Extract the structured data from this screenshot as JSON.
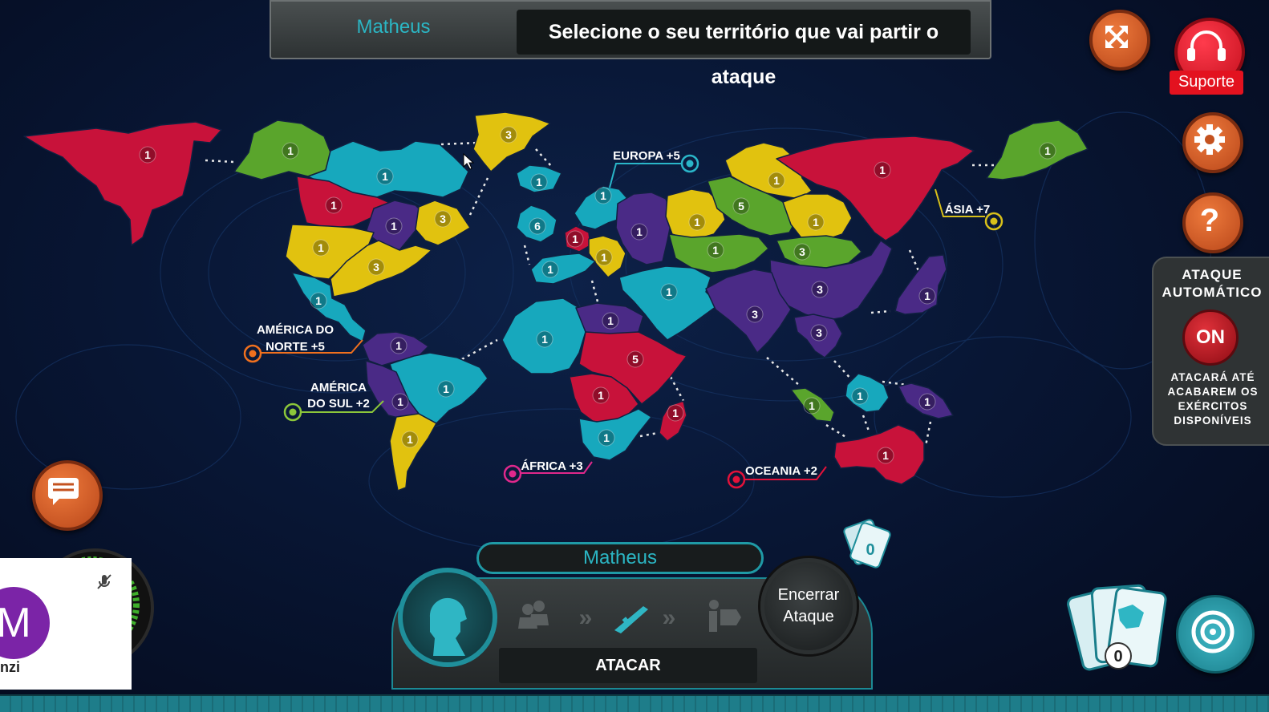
{
  "top_bar": {
    "player_name": "Matheus",
    "instruction": "Selecione o seu território que vai partir o ataque"
  },
  "support": {
    "label": "Suporte"
  },
  "auto_attack": {
    "title_line1": "ATAQUE",
    "title_line2": "AUTOMÁTICO",
    "toggle": "ON",
    "desc_line1": "ATACARÁ ATÉ",
    "desc_line2": "ACABAREM OS",
    "desc_line3": "EXÉRCITOS",
    "desc_line4": "DISPONÍVEIS"
  },
  "continents": {
    "north_america_line1": "AMÉRICA DO",
    "north_america_line2": "NORTE +5",
    "south_america_line1": "AMÉRICA",
    "south_america_line2": "DO SUL +2",
    "europe": "EUROPA +5",
    "asia": "ÁSIA +7",
    "africa": "ÁFRICA +3",
    "oceania": "OCEANIA +2"
  },
  "colors": {
    "red": "#c8123a",
    "green": "#5aa52c",
    "teal": "#17a8bd",
    "yellow": "#e1c20f",
    "purple": "#4a2a86",
    "label_europe": "#2ab6c9",
    "label_asia": "#d8c01a",
    "label_na": "#f0701e",
    "label_sa": "#8cc63a",
    "label_africa": "#e0288c",
    "label_oceania": "#e3123a"
  },
  "territories": [
    {
      "id": "alaska",
      "army": "1",
      "color": "red"
    },
    {
      "id": "mackenzie",
      "army": "1",
      "color": "green"
    },
    {
      "id": "vancouver",
      "army": "1",
      "color": "teal"
    },
    {
      "id": "greenland",
      "army": "3",
      "color": "yellow"
    },
    {
      "id": "ottawa",
      "army": "1",
      "color": "red"
    },
    {
      "id": "labrador",
      "army": "1",
      "color": "purple"
    },
    {
      "id": "quebec",
      "army": "3",
      "color": "yellow"
    },
    {
      "id": "california",
      "army": "1",
      "color": "yellow"
    },
    {
      "id": "new-york",
      "army": "3",
      "color": "yellow"
    },
    {
      "id": "mexico",
      "army": "1",
      "color": "teal"
    },
    {
      "id": "iceland",
      "army": "1",
      "color": "teal"
    },
    {
      "id": "england",
      "army": "6",
      "color": "teal"
    },
    {
      "id": "sweden",
      "army": "1",
      "color": "teal"
    },
    {
      "id": "germany",
      "army": "1",
      "color": "red"
    },
    {
      "id": "poland",
      "army": "1",
      "color": "yellow"
    },
    {
      "id": "moscow",
      "army": "1",
      "color": "purple"
    },
    {
      "id": "portugal",
      "army": "1",
      "color": "teal"
    },
    {
      "id": "colombia",
      "army": "1",
      "color": "purple"
    },
    {
      "id": "brazil",
      "army": "1",
      "color": "teal"
    },
    {
      "id": "peru",
      "army": "1",
      "color": "purple"
    },
    {
      "id": "argentina",
      "army": "1",
      "color": "yellow"
    },
    {
      "id": "algeria",
      "army": "1",
      "color": "teal"
    },
    {
      "id": "egypt",
      "army": "1",
      "color": "purple"
    },
    {
      "id": "sudan",
      "army": "5",
      "color": "red"
    },
    {
      "id": "congo",
      "army": "1",
      "color": "red"
    },
    {
      "id": "south-africa",
      "army": "1",
      "color": "teal"
    },
    {
      "id": "madagascar",
      "army": "1",
      "color": "red"
    },
    {
      "id": "middle-east",
      "army": "1",
      "color": "teal"
    },
    {
      "id": "omsk",
      "army": "1",
      "color": "yellow"
    },
    {
      "id": "aral",
      "army": "1",
      "color": "yellow"
    },
    {
      "id": "dudinka",
      "army": "5",
      "color": "green"
    },
    {
      "id": "siberia",
      "army": "1",
      "color": "red"
    },
    {
      "id": "tchita",
      "army": "1",
      "color": "yellow"
    },
    {
      "id": "mongolia",
      "army": "3",
      "color": "green"
    },
    {
      "id": "vladivostok",
      "army": "1",
      "color": "green"
    },
    {
      "id": "kazakh",
      "army": "1",
      "color": "green"
    },
    {
      "id": "china",
      "army": "3",
      "color": "purple"
    },
    {
      "id": "india",
      "army": "3",
      "color": "purple"
    },
    {
      "id": "vietnam",
      "army": "3",
      "color": "purple"
    },
    {
      "id": "japan",
      "army": "1",
      "color": "purple"
    },
    {
      "id": "sumatra",
      "army": "1",
      "color": "green"
    },
    {
      "id": "borneo",
      "army": "1",
      "color": "teal"
    },
    {
      "id": "new-guinea",
      "army": "1",
      "color": "purple"
    },
    {
      "id": "australia",
      "army": "1",
      "color": "red"
    }
  ],
  "bottom_panel": {
    "player_name": "Matheus",
    "action": "ATACAR",
    "end_line1": "Encerrar",
    "end_line2": "Ataque"
  },
  "cards": {
    "count_top": "0",
    "count_deck": "0"
  },
  "video": {
    "initial": "M",
    "name": "nzi"
  }
}
